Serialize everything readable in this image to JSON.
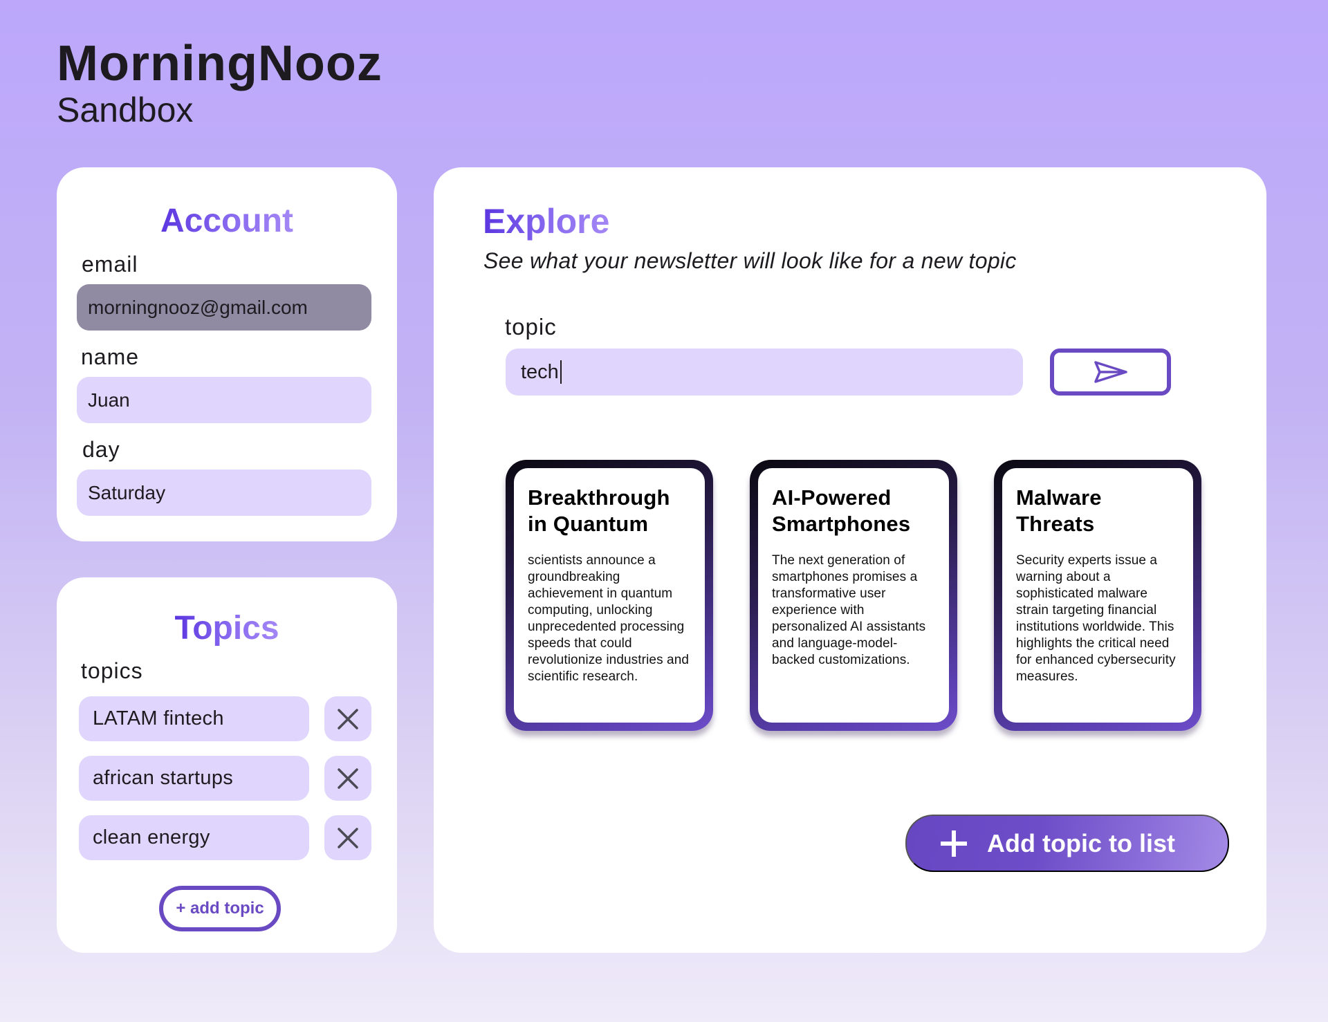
{
  "brand": {
    "title": "MorningNooz",
    "subtitle": "Sandbox"
  },
  "colors": {
    "accent": "#6a4ac2",
    "title_gradient_start": "#5b36e0",
    "title_gradient_end": "#a487f5",
    "input_bg": "#e0d6fd",
    "disabled_input_bg": "#908aa3"
  },
  "account": {
    "title": "Account",
    "email_label": "email",
    "email_value": "morningnooz@gmail.com",
    "name_label": "name",
    "name_value": "Juan",
    "day_label": "day",
    "day_value": "Saturday"
  },
  "topics": {
    "title": "Topics",
    "list_label": "topics",
    "items": [
      {
        "label": "LATAM fintech",
        "remove_icon": "close-icon"
      },
      {
        "label": "african startups",
        "remove_icon": "close-icon"
      },
      {
        "label": "clean energy",
        "remove_icon": "close-icon"
      }
    ],
    "add_button_label": "+ add topic"
  },
  "explore": {
    "title": "Explore",
    "subtitle": "See what your newsletter will look like for a new topic",
    "topic_label": "topic",
    "topic_value": "tech",
    "send_icon": "send-icon",
    "cards": [
      {
        "title": "Breakthrough in Quantum",
        "body": "scientists announce a groundbreaking achievement in quantum computing, unlocking unprecedented processing speeds that could revolutionize industries and scientific research."
      },
      {
        "title": "AI-Powered Smartphones",
        "body": "The next generation of smartphones promises a transformative user experience with personalized AI assistants and language-model-backed customizations."
      },
      {
        "title": "Malware Threats",
        "body": "Security experts issue a warning about a sophisticated malware strain targeting financial institutions worldwide. This highlights the critical need for enhanced cybersecurity measures."
      }
    ],
    "add_to_list_label": "Add topic to list",
    "add_to_list_icon": "plus-icon"
  }
}
